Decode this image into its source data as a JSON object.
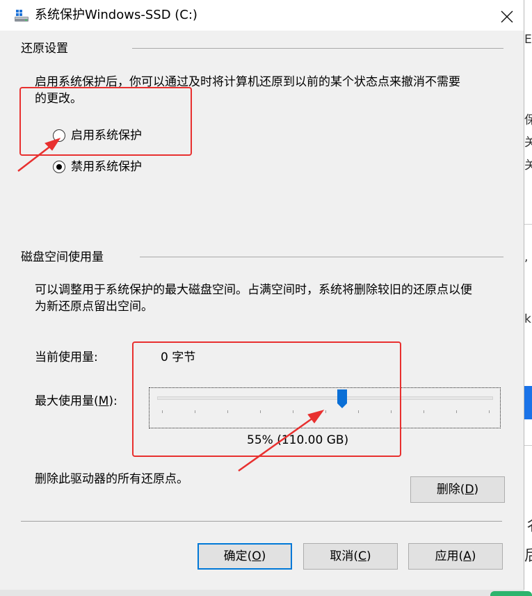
{
  "window": {
    "title": "系统保护Windows-SSD (C:)"
  },
  "restore": {
    "section_title": "还原设置",
    "description_line1": "启用系统保护后，你可以通过及时将计算机还原到以前的某个状态点来撤消不需要",
    "description_line2": "的更改。",
    "options": [
      {
        "label": "启用系统保护",
        "selected": false
      },
      {
        "label": "禁用系统保护",
        "selected": true
      }
    ]
  },
  "disk": {
    "section_title": "磁盘空间使用量",
    "description_line1": "可以调整用于系统保护的最大磁盘空间。占满空间时，系统将删除较旧的还原点以便",
    "description_line2": "为新还原点留出空间。",
    "current_usage_label": "当前使用量:",
    "current_usage_value": "0 字节",
    "max_usage_label_prefix": "最大使用量(",
    "max_usage_mnemonic": "M",
    "max_usage_label_suffix": "):",
    "slider_fraction": 0.55,
    "slider_readout": "55% (110.00 GB)",
    "delete_desc": "删除此驱动器的所有还原点。",
    "delete_button": {
      "prefix": "删除(",
      "mnemonic": "D",
      "suffix": ")"
    }
  },
  "footer": {
    "ok": {
      "prefix": "确定(",
      "mnemonic": "O",
      "suffix": ")"
    },
    "cancel": {
      "prefix": "取消(",
      "mnemonic": "C",
      "suffix": ")"
    },
    "apply": {
      "prefix": "应用(",
      "mnemonic": "A",
      "suffix": ")"
    }
  },
  "background_fragments": [
    "E",
    "保",
    "关",
    "关",
    ",",
    "k",
    "彳",
    "后"
  ],
  "colors": {
    "accent": "#0078d7",
    "slider_thumb": "#0a6fd6",
    "annotation": "#e8302f",
    "dialog_bg": "#f0f0f0"
  },
  "icons": {
    "title_icon": "drive-icon",
    "close": "close-icon"
  }
}
